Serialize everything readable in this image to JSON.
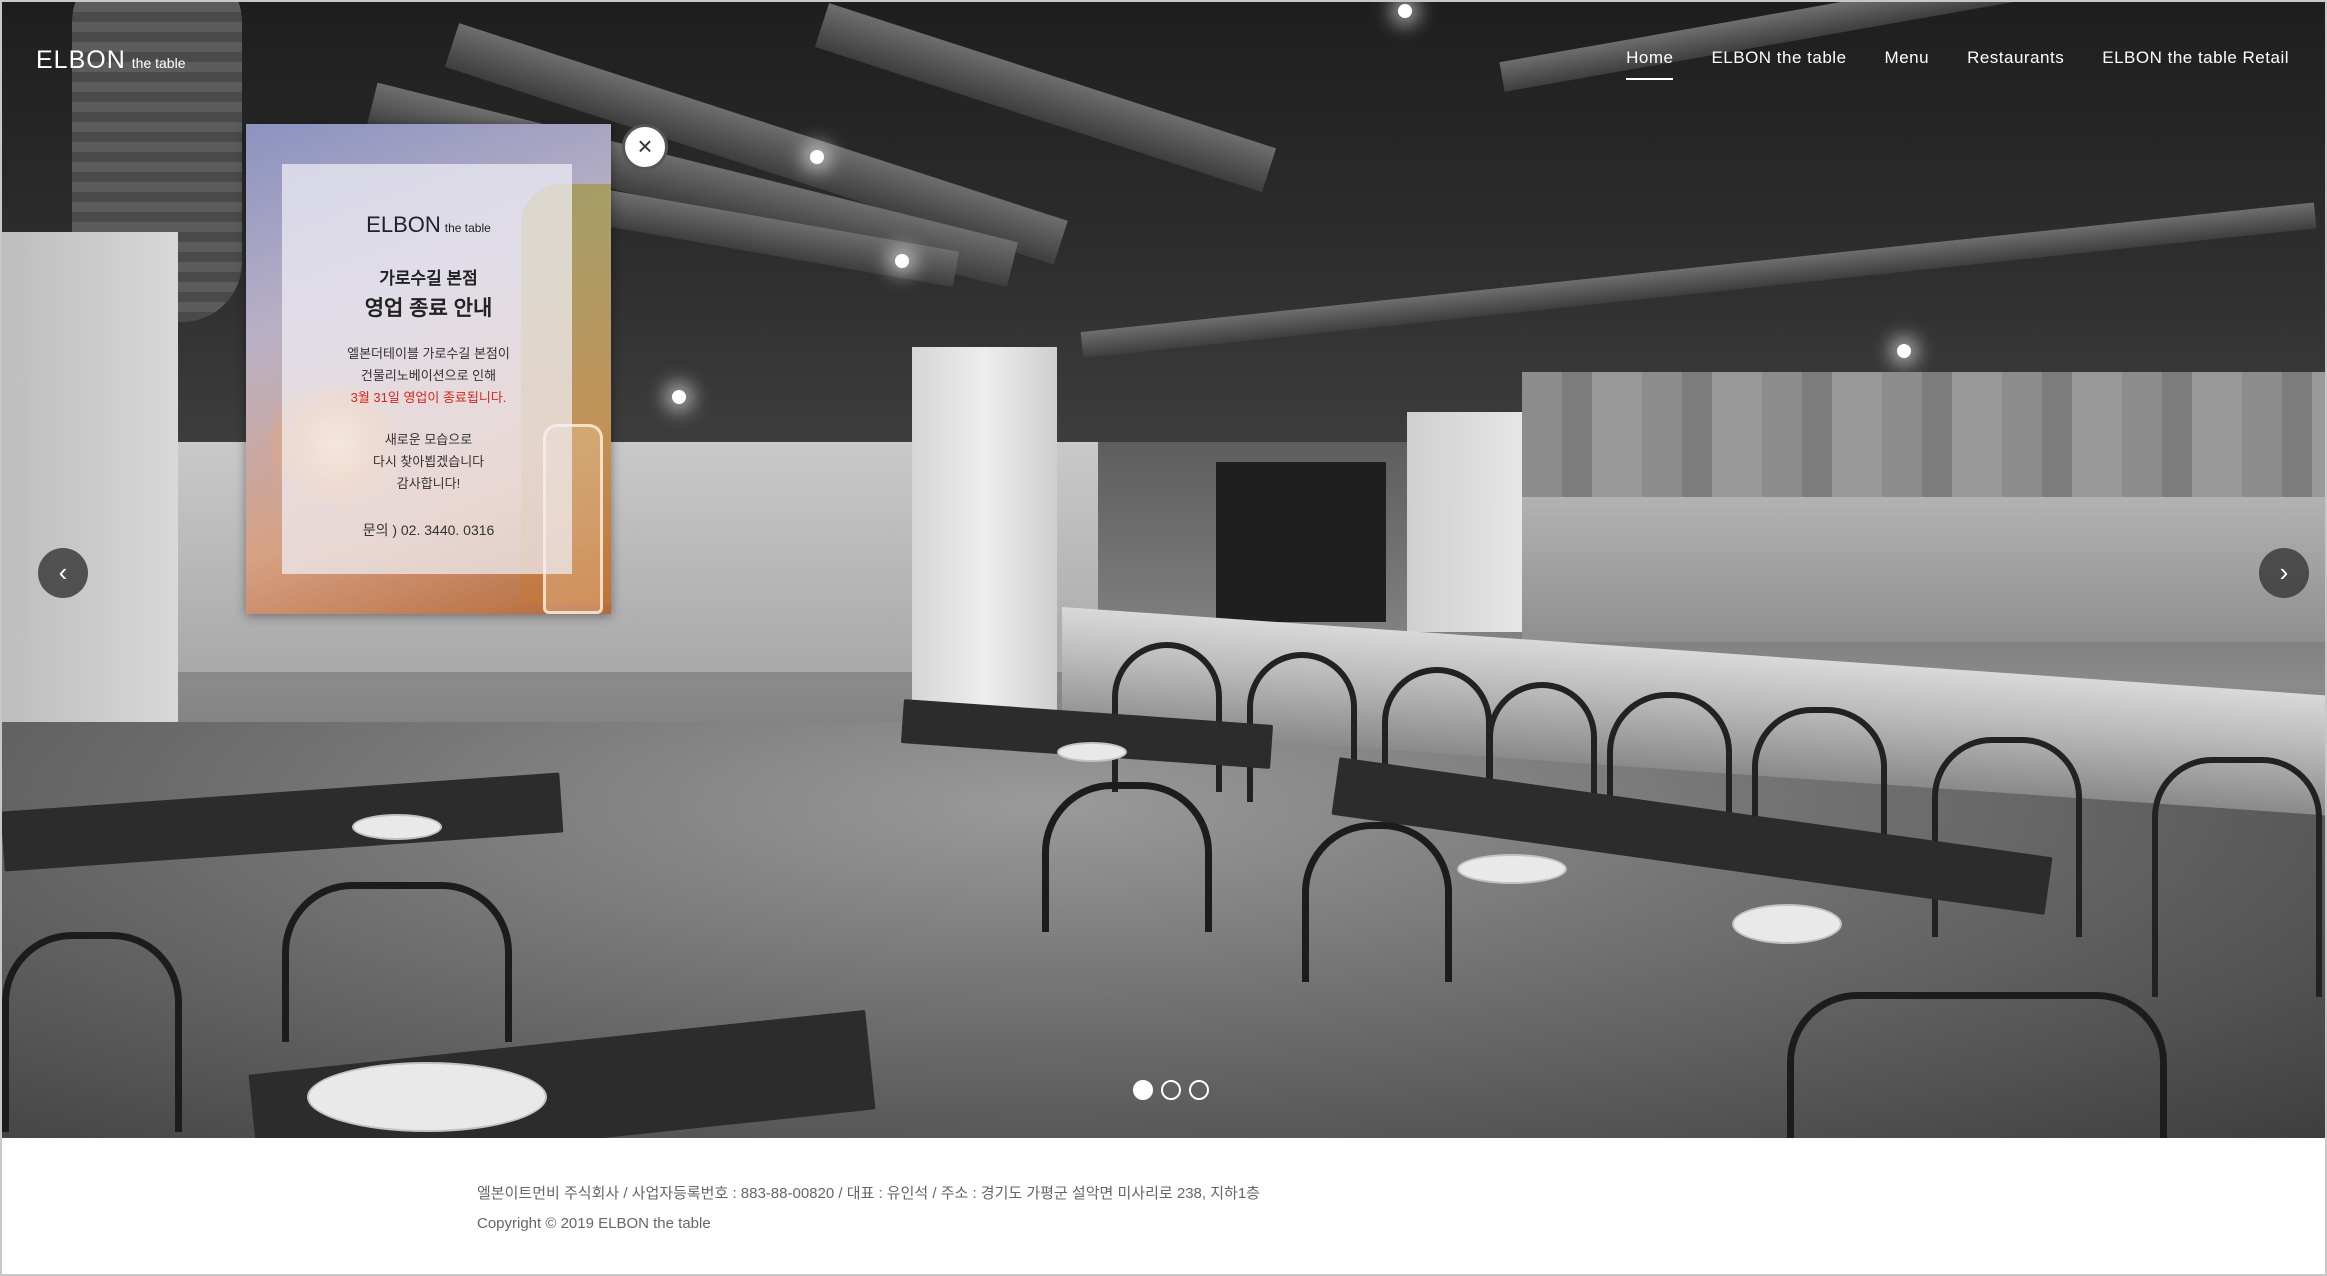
{
  "header": {
    "logo": "ELBON",
    "logo_sub": "the table",
    "nav": [
      "Home",
      "ELBON the table",
      "Menu",
      "Restaurants",
      "ELBON the table Retail"
    ]
  },
  "popup": {
    "logo": "ELBON",
    "logo_sub": "the table",
    "title_line1": "가로수길 본점",
    "title_line2": "영업 종료 안내",
    "body_line1": "엘본더테이블 가로수길 본점이",
    "body_line2": "건물리노베이션으로 인해",
    "body_line3": "3월 31일 영업이 종료됩니다.",
    "body_line4": "새로운 모습으로",
    "body_line5": "다시 찾아뵙겠습니다",
    "body_line6": "감사합니다!",
    "contact": "문의 ) 02. 3440. 0316",
    "close_icon": "×"
  },
  "slider": {
    "prev_icon": "‹",
    "next_icon": "›",
    "slide_count": 3,
    "active_index": 0
  },
  "footer": {
    "company_info": "엘본이트먼비 주식회사 / 사업자등록번호 : 883-88-00820 / 대표 : 유인석 / 주소 : 경기도 가평군 설악면 미사리로 238, 지하1층",
    "copyright": "Copyright © 2019 ELBON the table"
  },
  "colors": {
    "highlight_red": "#d9261c",
    "nav_text": "#ffffff",
    "footer_text": "#666666"
  }
}
